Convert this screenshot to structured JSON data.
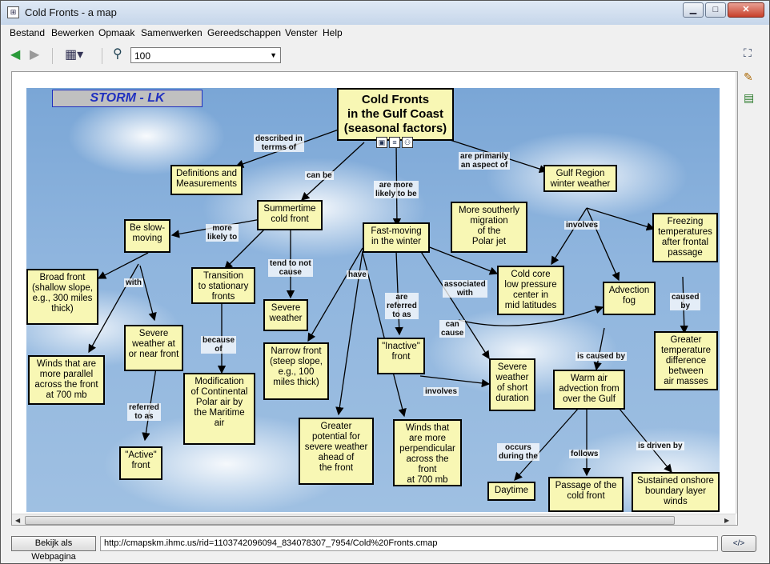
{
  "window": {
    "title": "Cold Fronts - a map",
    "icon": "concept-map-icon"
  },
  "window_controls": {
    "minimize": "▁",
    "maximize": "□",
    "close": "✕"
  },
  "menu": [
    "Bestand",
    "Bewerken",
    "Opmaak",
    "Samenwerken",
    "Gereedschappen",
    "Venster",
    "Help"
  ],
  "toolbar": {
    "back_icon": "back-arrow-icon",
    "forward_icon": "forward-arrow-icon",
    "view_icon": "map-view-icon",
    "zoom_icon": "zoom-icon",
    "zoom_value": "100"
  },
  "map": {
    "storm_label": "STORM - LK",
    "colors": {
      "node_fill": "#f8f7b4",
      "storm_text": "#2030c0",
      "sky": "#8fb5de"
    },
    "nodes": {
      "cold_fronts": "Cold Fronts\nin the Gulf Coast\n(seasonal factors)",
      "definitions": "Definitions and\nMeasurements",
      "summertime": "Summertime\ncold front",
      "fast_moving": "Fast-moving\nin the winter",
      "gulf_region": "Gulf Region\nwinter weather",
      "slow_moving": "Be slow-\nmoving",
      "broad_front": "Broad front\n(shallow slope,\ne.g., 300 miles\nthick)",
      "winds_parallel": "Winds that are\nmore parallel\nacross the front\nat 700 mb",
      "severe_near": "Severe\nweather at\nor near front",
      "active_front": "\"Active\"\nfront",
      "transition": "Transition\nto stationary\nfronts",
      "modification": "Modification\nof Continental\nPolar air by\nthe Maritime\nair",
      "severe_weather": "Severe\nweather",
      "narrow_front": "Narrow front\n(steep slope,\ne.g., 100\nmiles thick)",
      "greater_potential": "Greater\npotential for\nsevere weather\nahead of\nthe front",
      "winds_perpendicular": "Winds that\nare more\nperpendicular\nacross the\nfront\nat 700 mb",
      "inactive_front": "\"Inactive\"\nfront",
      "more_southerly": "More southerly\nmigration\nof the\nPolar jet",
      "cold_core": "Cold core\nlow pressure\ncenter in\nmid latitudes",
      "freezing": "Freezing\ntemperatures\nafter frontal\npassage",
      "advection_fog": "Advection\nfog",
      "severe_short": "Severe\nweather\nof short\nduration",
      "greater_temp": "Greater\ntemperature\ndifference\nbetween\nair masses",
      "warm_air": "Warm air\nadvection from\nover the Gulf",
      "daytime": "Daytime",
      "passage": "Passage of the\ncold front",
      "sustained": "Sustained onshore\nboundary layer\nwinds"
    },
    "links": {
      "described_in": "described in\nterrms of",
      "can_be": "can be",
      "are_more_likely": "are more\nlikely to be",
      "are_primarily": "are primarily\nan aspect of",
      "more_likely_to": "more\nlikely to",
      "with": "with",
      "tend_to_not": "tend to not\ncause",
      "have": "have",
      "involves_top": "involves",
      "because_of": "because\nof",
      "referred_to_as_1": "referred\nto as",
      "are_referred": "are\nreferred\nto as",
      "associated_with": "associated\nwith",
      "can_cause": "can\ncause",
      "caused_by": "caused\nby",
      "is_caused_by": "is caused by",
      "involves_bottom": "involves",
      "occurs_during": "occurs\nduring the",
      "follows": "follows",
      "is_driven_by": "is driven by"
    }
  },
  "status": {
    "web_button": "Bekijk als Webpagina",
    "url": "http://cmapskm.ihmc.us/rid=1103742096094_834078307_7954/Cold%20Fronts.cmap",
    "code_button": "</>"
  }
}
